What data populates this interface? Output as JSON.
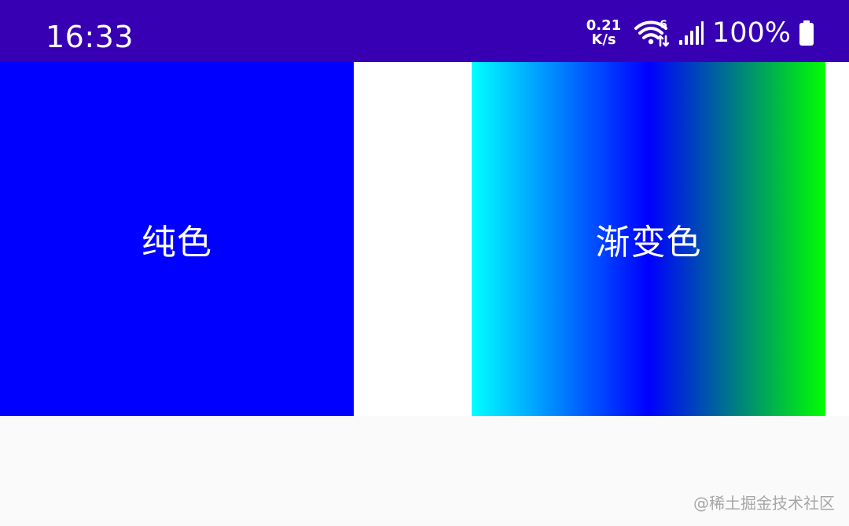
{
  "status_bar": {
    "time": "16:33",
    "net_speed_value": "0.21",
    "net_speed_unit": "K/s",
    "wifi_badge": "6",
    "battery_percent": "100%",
    "icons": [
      "wifi-icon",
      "signal-icon",
      "battery-icon"
    ]
  },
  "boxes": {
    "solid": {
      "label": "纯色",
      "color": "#0000FF"
    },
    "gradient": {
      "label": "渐变色",
      "colors": [
        "#00FFFF",
        "#0000FF",
        "#00FF00"
      ]
    }
  },
  "watermark": {
    "text": "@稀土掘金技术社区"
  },
  "colors": {
    "status_bar_bg": "#3700B3",
    "content_bg": "#FFFFFF",
    "page_bg": "#FAFAFA"
  }
}
